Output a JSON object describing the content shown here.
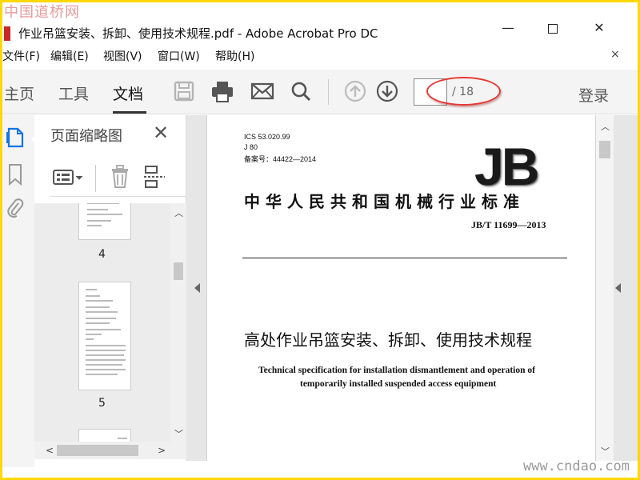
{
  "watermark": {
    "top": "中国道桥网",
    "bottom": "www.cndao.com"
  },
  "window": {
    "title": "作业吊篮安装、拆卸、使用技术规程.pdf - Adobe Acrobat Pro DC",
    "minimize": "—",
    "close": "✕"
  },
  "menu": {
    "items": [
      "文件(F)",
      "编辑(E)",
      "视图(V)",
      "窗口(W)",
      "帮助(H)"
    ],
    "close": "×"
  },
  "toolbar": {
    "tabs": [
      "主页",
      "工具",
      "文档"
    ],
    "active_tab": "文档",
    "page_current": "",
    "page_total": "/ 18",
    "login": "登录",
    "icons": [
      "save-icon",
      "print-icon",
      "mail-icon",
      "search-icon",
      "previous-page-icon",
      "next-page-icon"
    ]
  },
  "left_rail": {
    "icons": [
      "page-thumbnails-icon",
      "bookmark-icon",
      "attachment-icon"
    ]
  },
  "thumbnails_panel": {
    "title": "页面缩略图",
    "close": "✕",
    "pages": [
      {
        "label": "4"
      },
      {
        "label": "5"
      }
    ]
  },
  "document": {
    "ics": "ICS 53.020.99",
    "class": "J 80",
    "filing": "备案号：44422—2014",
    "logo": "JB",
    "standard_title": "中华人民共和国机械行业标准",
    "standard_number": "JB/T 11699—2013",
    "title_cn": "高处作业吊篮安装、拆卸、使用技术规程",
    "title_en_line1": "Technical specification for installation dismantlement and operation of",
    "title_en_line2": "temporarily installed suspended access equipment"
  },
  "colors": {
    "frame": "#ffd800",
    "highlight_ellipse": "#e53935",
    "acrobat_red": "#c62828",
    "active_icon_blue": "#1473e6"
  }
}
